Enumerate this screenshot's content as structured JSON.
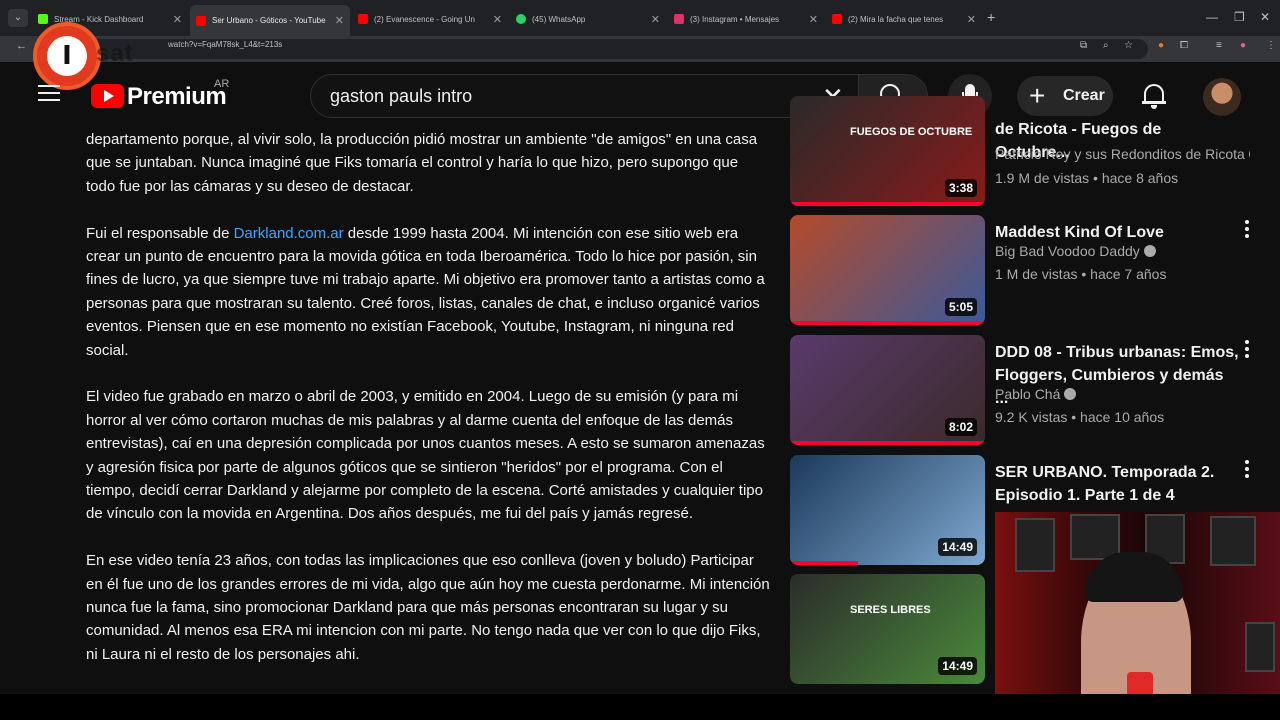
{
  "browser": {
    "tabs": [
      {
        "label": "Stream - Kick Dashboard",
        "color": "#53fc18"
      },
      {
        "label": "Ser Urbano - Góticos - YouTube",
        "color": "#ff0000"
      },
      {
        "label": "(2) Evanescence - Going Un",
        "color": "#ff0000"
      },
      {
        "label": "(45) WhatsApp",
        "color": "#25d366"
      },
      {
        "label": "(3) Instagram • Mensajes",
        "color": "#e1306c"
      },
      {
        "label": "(2) Mira la facha que tenes",
        "color": "#ff0000"
      }
    ],
    "url": "watch?v=FqaM78sk_L4&t=213s",
    "overlay_logo_text": "sat",
    "overlay_logo_letter": "I"
  },
  "masthead": {
    "brand": "Premium",
    "region": "AR",
    "search_value": "gaston pauls intro",
    "create_label": "Crear"
  },
  "description": {
    "p1": "departamento porque, al vivir solo, la producción pidió mostrar un ambiente \"de amigos\" en una casa que se juntaban. Nunca imaginé que Fiks tomaría el control y haría lo que hizo, pero supongo que todo fue por las cámaras y su deseo de destacar.",
    "p2_before": "Fui el responsable de ",
    "p2_link": "Darkland.com.ar",
    "p2_after": " desde 1999 hasta 2004. Mi intención con ese sitio web era crear un punto de encuentro para la movida gótica en toda Iberoamérica. Todo lo hice por pasión, sin fines de lucro, ya que siempre tuve mi trabajo aparte. Mi objetivo era promover tanto a artistas como a personas para que mostraran su talento. Creé foros, listas, canales de chat, e incluso organicé varios eventos. Piensen que en ese momento no existían Facebook, Youtube, Instagram, ni ninguna red social.",
    "p3": "El video fue grabado en marzo o abril de 2003, y emitido en 2004. Luego de su emisión (y para mi horror al ver cómo cortaron muchas de mis palabras y al darme cuenta del enfoque de las demás entrevistas), caí en una depresión complicada por unos cuantos meses. A esto se sumaron amenazas y agresión fisica por parte de algunos góticos que se sintieron \"heridos\" por el programa. Con el tiempo, decidí cerrar Darkland y alejarme por completo de la escena. Corté amistades y cualquier tipo de vínculo con la movida en Argentina. Dos años después, me fui del país y jamás regresé.",
    "p4": "En ese video tenía 23 años, con todas las implicaciones que eso conlleva (joven y boludo) Participar en él fue uno de los grandes errores de mi vida, algo que aún hoy me cuesta perdonarme. Mi intención nunca fue la fama, sino promocionar Darkland para que más personas encontraran su lugar y su comunidad. Al menos esa ERA mi intencion con mi parte. No tengo nada que ver con lo que dijo Fiks, ni Laura ni el resto de los personajes ahi."
  },
  "related": [
    {
      "title": "de Ricota - Fuegos de Octubre...",
      "channel": "Patricio Rey y sus Redonditos de Ricota",
      "meta": "1.9 M de vistas • hace 8 años",
      "duration": "3:38",
      "watched": 1.0,
      "thumb_colors": [
        "#2a2a2a",
        "#8a1a1a"
      ],
      "thumb_text": "FUEGOS DE OCTUBRE"
    },
    {
      "title": "Maddest Kind Of Love",
      "channel": "Big Bad Voodoo Daddy",
      "meta": "1 M de vistas • hace 7 años",
      "duration": "5:05",
      "watched": 1.0,
      "thumb_colors": [
        "#b44a2a",
        "#3a5a9a"
      ],
      "thumb_text": ""
    },
    {
      "title": "DDD 08 - Tribus urbanas: Emos, Floggers, Cumbieros y demás ...",
      "channel": "Pablo Chá",
      "meta": "9.2 K vistas • hace 10 años",
      "duration": "8:02",
      "watched": 1.0,
      "thumb_colors": [
        "#5a3a6a",
        "#3a2a2a"
      ],
      "thumb_text": ""
    },
    {
      "title": "SER URBANO. Temporada 2. Episodio 1. Parte 1 de 4",
      "channel": "",
      "meta": "",
      "duration": "14:49",
      "watched": 0.35,
      "thumb_colors": [
        "#1c3a5a",
        "#7fa8d0"
      ],
      "thumb_text": ""
    },
    {
      "title": "",
      "channel": "",
      "meta": "",
      "duration": "14:49",
      "watched": 0,
      "thumb_colors": [
        "#2c2c2c",
        "#4a8a3a"
      ],
      "thumb_text": "SERES LIBRES"
    }
  ]
}
